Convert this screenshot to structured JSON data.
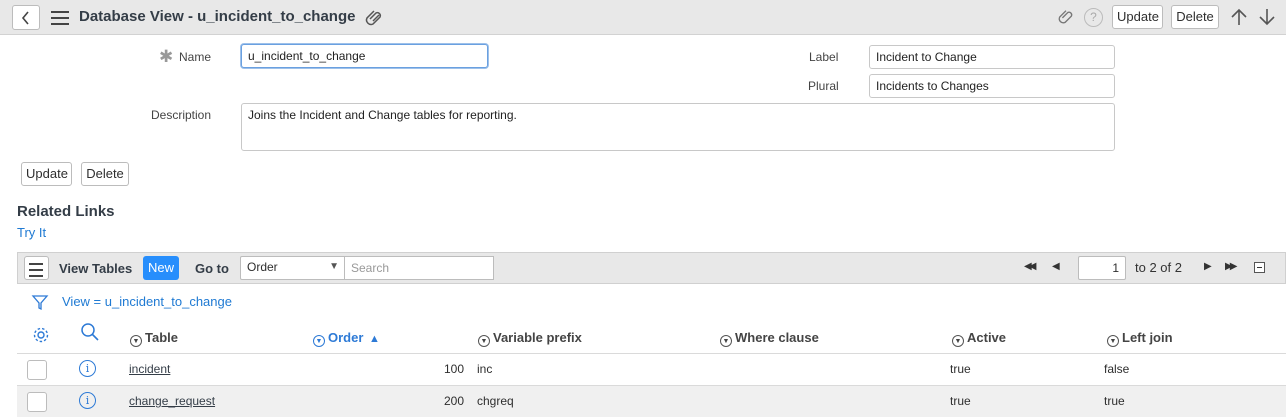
{
  "header": {
    "title": "Database View - u_incident_to_change",
    "update_label": "Update",
    "delete_label": "Delete",
    "help_glyph": "?"
  },
  "form": {
    "name_label": "Name",
    "name_value": "u_incident_to_change",
    "description_label": "Description",
    "description_value": "Joins the Incident and Change tables for reporting.",
    "label_label": "Label",
    "label_value": "Incident to Change",
    "plural_label": "Plural",
    "plural_value": "Incidents to Changes",
    "update_label": "Update",
    "delete_label": "Delete"
  },
  "related_links": {
    "title": "Related Links",
    "try_it": "Try It"
  },
  "list": {
    "title": "View Tables",
    "new_label": "New",
    "goto_label": "Go to",
    "goto_selected": "Order",
    "search_placeholder": "Search",
    "page_value": "1",
    "page_total": "to 2 of 2",
    "filter_text": "View = u_incident_to_change",
    "columns": {
      "table": "Table",
      "order": "Order",
      "variable_prefix": "Variable prefix",
      "where_clause": "Where clause",
      "active": "Active",
      "left_join": "Left join"
    },
    "rows": [
      {
        "table": "incident",
        "order": "100",
        "variable_prefix": "inc",
        "where_clause": "",
        "active": "true",
        "left_join": "false"
      },
      {
        "table": "change_request",
        "order": "200",
        "variable_prefix": "chgreq",
        "where_clause": "",
        "active": "true",
        "left_join": "true"
      }
    ]
  },
  "colors": {
    "accent_blue": "#278efc",
    "link_blue": "#1f7ad3",
    "header_bg": "#e8e8e8",
    "row_alt_bg": "#f0f0f0"
  }
}
